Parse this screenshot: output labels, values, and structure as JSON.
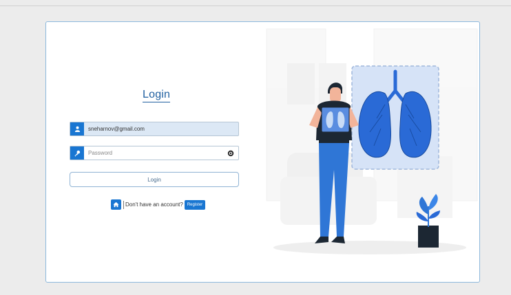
{
  "login": {
    "title": "Login",
    "email_value": "sneharnov@gmail.com",
    "password_placeholder": "Password",
    "button_label": "Login",
    "no_account_text": "Don't have an account?",
    "register_label": "Register"
  },
  "icons": {
    "email": "user-icon",
    "password": "key-icon",
    "toggle": "eye-icon",
    "home": "home-icon"
  },
  "colors": {
    "accent": "#1976d2",
    "title": "#1f5fa0",
    "border": "#8cb8dc",
    "lung": "#2a6ad6",
    "lung_panel": "#d6e3f7"
  }
}
